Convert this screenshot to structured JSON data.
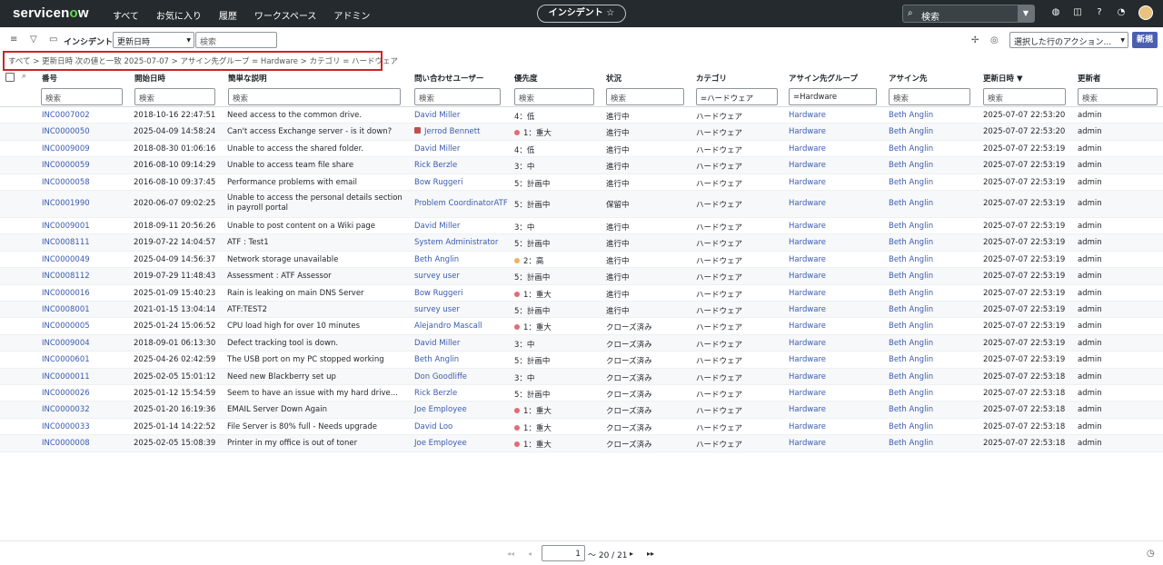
{
  "nav": {
    "logo": "servicenow",
    "menu": [
      "すべて",
      "お気に入り",
      "履歴",
      "ワークスペース",
      "アドミン"
    ],
    "title": "インシデント ☆",
    "search_placeholder": "検索"
  },
  "toolbar": {
    "title": "インシデント",
    "sort_field": "更新日時",
    "search_placeholder": "検索",
    "action_select": "選択した行のアクション...",
    "new_button": "新規"
  },
  "breadcrumb": "すべて  > 更新日時 次の値と一致 2025-07-07 > アサイン先グループ = Hardware > カテゴリ = ハードウェア",
  "columns": [
    "番号",
    "開始日時",
    "簡単な説明",
    "問い合わせユーザー",
    "優先度",
    "状況",
    "カテゴリ",
    "アサイン先グループ",
    "アサイン先",
    "更新日時 ▼",
    "更新者"
  ],
  "filters": [
    "検索",
    "検索",
    "検索",
    "検索",
    "検索",
    "検索",
    "=ハードウェア",
    "=Hardware",
    "検索",
    "検索",
    "検索"
  ],
  "rows": [
    {
      "number": "INC0007002",
      "opened": "2018-10-16 22:47:51",
      "desc": "Need access to the common drive.",
      "caller": "David Miller",
      "priority": "4：低",
      "pcolor": "",
      "state": "進行中",
      "category": "ハードウェア",
      "group": "Hardware",
      "assignee": "Beth Anglin",
      "updated": "2025-07-07 22:53:20",
      "by": "admin"
    },
    {
      "number": "INC0000050",
      "opened": "2025-04-09 14:58:24",
      "desc": "Can't access Exchange server - is it down?",
      "caller": "Jerrod Bennett",
      "priority": "1：重大",
      "pcolor": "#e06c75",
      "state": "進行中",
      "category": "ハードウェア",
      "group": "Hardware",
      "assignee": "Beth Anglin",
      "updated": "2025-07-07 22:53:20",
      "by": "admin"
    },
    {
      "number": "INC0009009",
      "opened": "2018-08-30 01:06:16",
      "desc": "Unable to access the shared folder.",
      "caller": "David Miller",
      "priority": "4：低",
      "pcolor": "",
      "state": "進行中",
      "category": "ハードウェア",
      "group": "Hardware",
      "assignee": "Beth Anglin",
      "updated": "2025-07-07 22:53:19",
      "by": "admin"
    },
    {
      "number": "INC0000059",
      "opened": "2016-08-10 09:14:29",
      "desc": "Unable to access team file share",
      "caller": "Rick Berzle",
      "priority": "3：中",
      "pcolor": "",
      "state": "進行中",
      "category": "ハードウェア",
      "group": "Hardware",
      "assignee": "Beth Anglin",
      "updated": "2025-07-07 22:53:19",
      "by": "admin"
    },
    {
      "number": "INC0000058",
      "opened": "2016-08-10 09:37:45",
      "desc": "Performance problems with email",
      "caller": "Bow Ruggeri",
      "priority": "5：計画中",
      "pcolor": "",
      "state": "進行中",
      "category": "ハードウェア",
      "group": "Hardware",
      "assignee": "Beth Anglin",
      "updated": "2025-07-07 22:53:19",
      "by": "admin"
    },
    {
      "number": "INC0001990",
      "opened": "2020-06-07 09:02:25",
      "desc": "Unable to access the personal details section in payroll portal",
      "caller": "Problem CoordinatorATF",
      "priority": "5：計画中",
      "pcolor": "",
      "state": "保留中",
      "category": "ハードウェア",
      "group": "Hardware",
      "assignee": "Beth Anglin",
      "updated": "2025-07-07 22:53:19",
      "by": "admin"
    },
    {
      "number": "INC0009001",
      "opened": "2018-09-11 20:56:26",
      "desc": "Unable to post content on a Wiki page",
      "caller": "David Miller",
      "priority": "3：中",
      "pcolor": "",
      "state": "進行中",
      "category": "ハードウェア",
      "group": "Hardware",
      "assignee": "Beth Anglin",
      "updated": "2025-07-07 22:53:19",
      "by": "admin"
    },
    {
      "number": "INC0008111",
      "opened": "2019-07-22 14:04:57",
      "desc": "ATF : Test1",
      "caller": "System Administrator",
      "priority": "5：計画中",
      "pcolor": "",
      "state": "進行中",
      "category": "ハードウェア",
      "group": "Hardware",
      "assignee": "Beth Anglin",
      "updated": "2025-07-07 22:53:19",
      "by": "admin"
    },
    {
      "number": "INC0000049",
      "opened": "2025-04-09 14:56:37",
      "desc": "Network storage unavailable",
      "caller": "Beth Anglin",
      "priority": "2：高",
      "pcolor": "#f0b35a",
      "state": "進行中",
      "category": "ハードウェア",
      "group": "Hardware",
      "assignee": "Beth Anglin",
      "updated": "2025-07-07 22:53:19",
      "by": "admin"
    },
    {
      "number": "INC0008112",
      "opened": "2019-07-29 11:48:43",
      "desc": "Assessment : ATF Assessor",
      "caller": "survey user",
      "priority": "5：計画中",
      "pcolor": "",
      "state": "進行中",
      "category": "ハードウェア",
      "group": "Hardware",
      "assignee": "Beth Anglin",
      "updated": "2025-07-07 22:53:19",
      "by": "admin"
    },
    {
      "number": "INC0000016",
      "opened": "2025-01-09 15:40:23",
      "desc": "Rain is leaking on main DNS Server",
      "caller": "Bow Ruggeri",
      "priority": "1：重大",
      "pcolor": "#e06c75",
      "state": "進行中",
      "category": "ハードウェア",
      "group": "Hardware",
      "assignee": "Beth Anglin",
      "updated": "2025-07-07 22:53:19",
      "by": "admin"
    },
    {
      "number": "INC0008001",
      "opened": "2021-01-15 13:04:14",
      "desc": "ATF:TEST2",
      "caller": "survey user",
      "priority": "5：計画中",
      "pcolor": "",
      "state": "進行中",
      "category": "ハードウェア",
      "group": "Hardware",
      "assignee": "Beth Anglin",
      "updated": "2025-07-07 22:53:19",
      "by": "admin"
    },
    {
      "number": "INC0000005",
      "opened": "2025-01-24 15:06:52",
      "desc": "CPU load high for over 10 minutes",
      "caller": "Alejandro Mascall",
      "priority": "1：重大",
      "pcolor": "#e06c75",
      "state": "クローズ済み",
      "category": "ハードウェア",
      "group": "Hardware",
      "assignee": "Beth Anglin",
      "updated": "2025-07-07 22:53:19",
      "by": "admin"
    },
    {
      "number": "INC0009004",
      "opened": "2018-09-01 06:13:30",
      "desc": "Defect tracking tool is down.",
      "caller": "David Miller",
      "priority": "3：中",
      "pcolor": "",
      "state": "クローズ済み",
      "category": "ハードウェア",
      "group": "Hardware",
      "assignee": "Beth Anglin",
      "updated": "2025-07-07 22:53:19",
      "by": "admin"
    },
    {
      "number": "INC0000601",
      "opened": "2025-04-26 02:42:59",
      "desc": "The USB port on my PC stopped working",
      "caller": "Beth Anglin",
      "priority": "5：計画中",
      "pcolor": "",
      "state": "クローズ済み",
      "category": "ハードウェア",
      "group": "Hardware",
      "assignee": "Beth Anglin",
      "updated": "2025-07-07 22:53:19",
      "by": "admin"
    },
    {
      "number": "INC0000011",
      "opened": "2025-02-05 15:01:12",
      "desc": "Need new Blackberry set up",
      "caller": "Don Goodliffe",
      "priority": "3：中",
      "pcolor": "",
      "state": "クローズ済み",
      "category": "ハードウェア",
      "group": "Hardware",
      "assignee": "Beth Anglin",
      "updated": "2025-07-07 22:53:18",
      "by": "admin"
    },
    {
      "number": "INC0000026",
      "opened": "2025-01-12 15:54:59",
      "desc": "Seem to have an issue with my hard drive...",
      "caller": "Rick Berzle",
      "priority": "5：計画中",
      "pcolor": "",
      "state": "クローズ済み",
      "category": "ハードウェア",
      "group": "Hardware",
      "assignee": "Beth Anglin",
      "updated": "2025-07-07 22:53:18",
      "by": "admin"
    },
    {
      "number": "INC0000032",
      "opened": "2025-01-20 16:19:36",
      "desc": "EMAIL Server Down Again",
      "caller": "Joe Employee",
      "priority": "1：重大",
      "pcolor": "#e06c75",
      "state": "クローズ済み",
      "category": "ハードウェア",
      "group": "Hardware",
      "assignee": "Beth Anglin",
      "updated": "2025-07-07 22:53:18",
      "by": "admin"
    },
    {
      "number": "INC0000033",
      "opened": "2025-01-14 14:22:52",
      "desc": "File Server is 80% full - Needs upgrade",
      "caller": "David Loo",
      "priority": "1：重大",
      "pcolor": "#e06c75",
      "state": "クローズ済み",
      "category": "ハードウェア",
      "group": "Hardware",
      "assignee": "Beth Anglin",
      "updated": "2025-07-07 22:53:18",
      "by": "admin"
    },
    {
      "number": "INC0000008",
      "opened": "2025-02-05 15:08:39",
      "desc": "Printer in my office is out of toner",
      "caller": "Joe Employee",
      "priority": "1：重大",
      "pcolor": "#e06c75",
      "state": "クローズ済み",
      "category": "ハードウェア",
      "group": "Hardware",
      "assignee": "Beth Anglin",
      "updated": "2025-07-07 22:53:18",
      "by": "admin"
    }
  ],
  "pager": {
    "page": "1",
    "range_text": "〜 20 / 21"
  }
}
